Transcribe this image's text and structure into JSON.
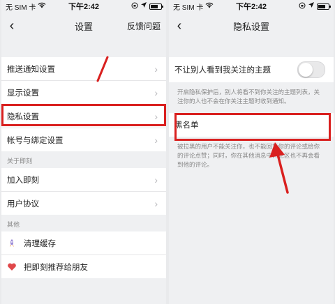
{
  "status_bar": {
    "carrier": "无 SIM 卡",
    "time": "下午2:42"
  },
  "left_screen": {
    "nav": {
      "title": "设置",
      "right_link": "反馈问题"
    },
    "group1": [
      {
        "label": "推送通知设置"
      },
      {
        "label": "显示设置"
      },
      {
        "label": "隐私设置"
      },
      {
        "label": "帐号与绑定设置"
      }
    ],
    "section_about": "关于即刻",
    "group2": [
      {
        "label": "加入即刻"
      },
      {
        "label": "用户协议"
      }
    ],
    "section_other": "其他",
    "group3": [
      {
        "label": "清理缓存",
        "icon": "rocket-icon"
      },
      {
        "label": "把即刻推荐给朋友",
        "icon": "heart-icon"
      }
    ]
  },
  "right_screen": {
    "nav": {
      "title": "隐私设置"
    },
    "toggle_row": {
      "label": "不让别人看到我关注的主题",
      "enabled": false
    },
    "toggle_desc": "开启隐私保护后，别人将看不到你关注的主题列表，关注你的人也不会在你关注主题时收到通知。",
    "blacklist_label": "黑名单",
    "blacklist_desc": "被拉黑的用户不能关注你，也不能回复你的评论或给你的评论点赞；同时，你在其他消息中评论区也不再会看到他的评论。"
  },
  "colors": {
    "highlight": "#d9201f",
    "background": "#eff0f2"
  }
}
